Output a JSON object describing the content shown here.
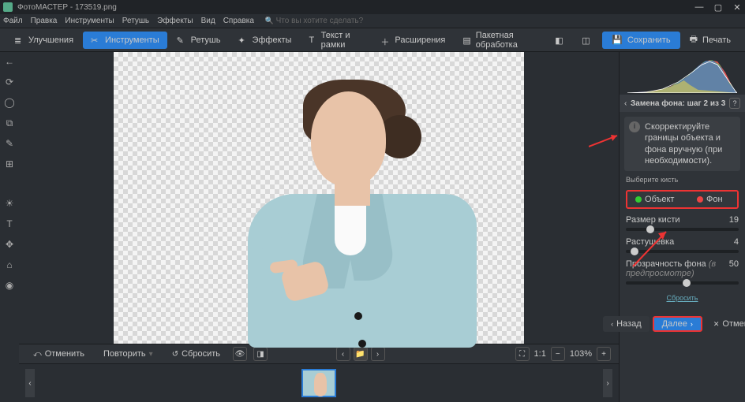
{
  "app": {
    "title": "ФотоМАСТЕР - 173519.png"
  },
  "menu": {
    "items": [
      "Файл",
      "Правка",
      "Инструменты",
      "Ретушь",
      "Эффекты",
      "Вид",
      "Справка"
    ],
    "search_placeholder": "Что вы хотите сделать?"
  },
  "toolbar": {
    "enhance": "Улучшения",
    "tools": "Инструменты",
    "retouch": "Ретушь",
    "effects": "Эффекты",
    "text": "Текст и рамки",
    "extensions": "Расширения",
    "batch": "Пакетная обработка",
    "save": "Сохранить",
    "print": "Печать"
  },
  "canvasbar": {
    "undo": "Отменить",
    "redo": "Повторить",
    "reset": "Сбросить",
    "zoom_ratio": "1:1",
    "zoom_pct": "103%"
  },
  "panel": {
    "title": "Замена фона: шаг 2 из 3",
    "hint": "Скорректируйте границы объекта и фона вручную (при необходимости).",
    "brush_label": "Выберите кисть",
    "obj": "Объект",
    "bg": "Фон",
    "size_label": "Размер кисти",
    "size_val": "19",
    "feather_label": "Растушевка",
    "feather_val": "4",
    "opacity_label": "Прозрачность фона",
    "opacity_hint": "(в предпросмотре)",
    "opacity_val": "50",
    "reset": "Сбросить",
    "back": "Назад",
    "next": "Далее",
    "cancel": "Отмена"
  },
  "colors": {
    "accent": "#2a7cd6",
    "highlight": "#e33"
  }
}
